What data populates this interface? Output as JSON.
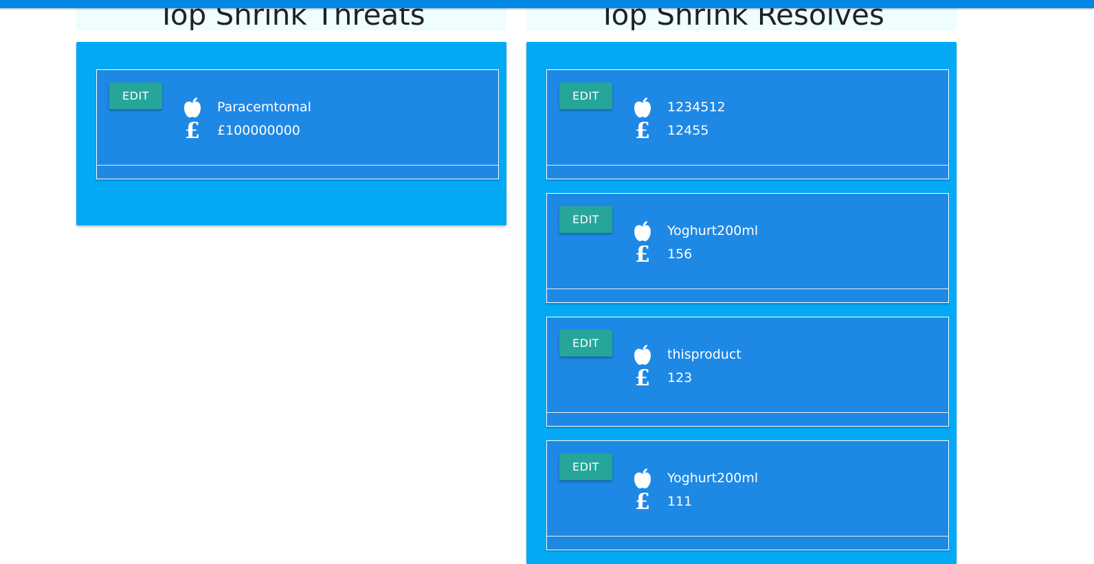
{
  "threats": {
    "title": "Top Shrink Threats",
    "items": [
      {
        "edit_label": "EDIT",
        "name": "Paracemtomal",
        "value": "£100000000"
      }
    ]
  },
  "resolves": {
    "title": "Top Shrink Resolves",
    "items": [
      {
        "edit_label": "EDIT",
        "name": "1234512",
        "value": "12455"
      },
      {
        "edit_label": "EDIT",
        "name": "Yoghurt200ml",
        "value": "156"
      },
      {
        "edit_label": "EDIT",
        "name": "thisproduct",
        "value": "123"
      },
      {
        "edit_label": "EDIT",
        "name": "Yoghurt200ml",
        "value": "111"
      }
    ]
  },
  "icons": {
    "product": "apple-icon",
    "price": "pound-icon"
  },
  "colors": {
    "topbar": "#0288e4",
    "header_bg": "#eefdfe",
    "panel": "#03a9f4",
    "card": "#1e88e5",
    "edit_button": "#26a69a"
  }
}
